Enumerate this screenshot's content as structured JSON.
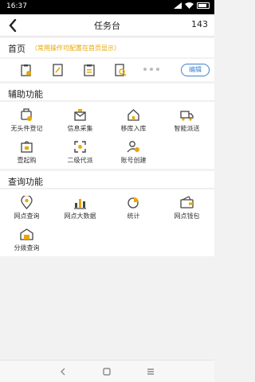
{
  "status_bar": {
    "time": "16:37"
  },
  "nav": {
    "title": "任务台",
    "count": "143"
  },
  "home": {
    "label": "首页",
    "hint": "（常用操作可配置在首页显示）",
    "edit_label": "编辑"
  },
  "assist": {
    "title": "辅助功能",
    "items": [
      "无头件登记",
      "信息采集",
      "移库入库",
      "智能派送",
      "壹起购",
      "二级代派",
      "账号创建"
    ]
  },
  "query": {
    "title": "查询功能",
    "items": [
      "网点查询",
      "网点大数据",
      "统计",
      "网点钱包",
      "分拨查询"
    ]
  },
  "colors": {
    "accent": "#e8a600",
    "link": "#3f7fd1",
    "icon_dark": "#444444"
  }
}
